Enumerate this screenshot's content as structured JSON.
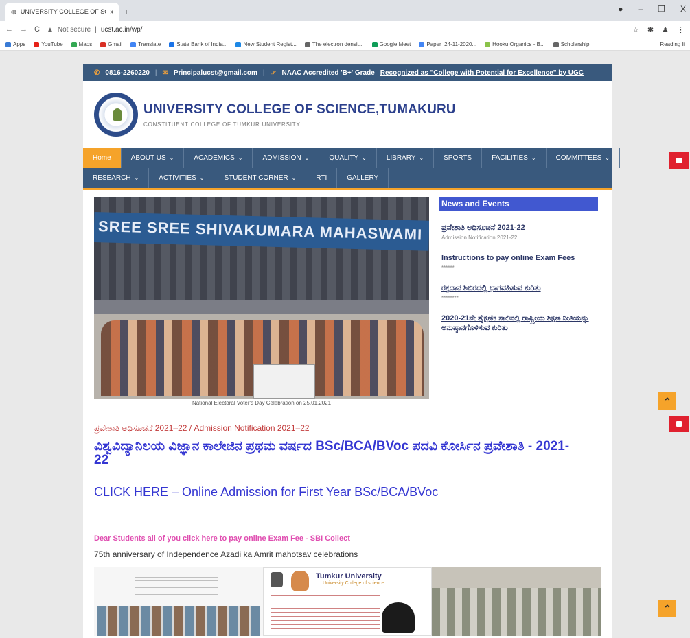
{
  "browser": {
    "tab_title": "UNIVERSITY COLLEGE OF SCIEN",
    "tab_close": "x",
    "new_tab": "+",
    "controls": {
      "minimize": "–",
      "restore": "❐",
      "close": "X"
    },
    "not_secure": "Not secure",
    "url": "ucst.ac.in/wp/",
    "bookmarks": [
      {
        "label": "Apps",
        "color": "#3a7bd5"
      },
      {
        "label": "YouTube",
        "color": "#e62117"
      },
      {
        "label": "Maps",
        "color": "#34a853"
      },
      {
        "label": "Gmail",
        "color": "#d93025"
      },
      {
        "label": "Translate",
        "color": "#4285f4"
      },
      {
        "label": "State Bank of India...",
        "color": "#1a73e8"
      },
      {
        "label": "New Student Regist...",
        "color": "#1e88e5"
      },
      {
        "label": "The electron densit...",
        "color": "#666666"
      },
      {
        "label": "Google Meet",
        "color": "#0f9d58"
      },
      {
        "label": "Paper_24-11-2020...",
        "color": "#4285f4"
      },
      {
        "label": "Hooku Organics - B...",
        "color": "#8bc34a"
      },
      {
        "label": "Scholarship",
        "color": "#666666"
      }
    ],
    "reading_list": "Reading li"
  },
  "site": {
    "phone": "0816-2260220",
    "email": "Principalucst@gmail.com",
    "naac": "NAAC Accredited 'B+' Grade",
    "ugc": "Recognized as \"College with Potential for Excellence\" by UGC",
    "title": "UNIVERSITY COLLEGE OF SCIENCE,TUMAKURU",
    "subtitle": "CONSTITUENT COLLEGE OF TUMKUR UNIVERSITY",
    "nav_row1": [
      {
        "label": "Home",
        "active": true,
        "dropdown": false
      },
      {
        "label": "ABOUT US",
        "dropdown": true
      },
      {
        "label": "ACADEMICS",
        "dropdown": true
      },
      {
        "label": "ADMISSION",
        "dropdown": true
      },
      {
        "label": "QUALITY",
        "dropdown": true
      },
      {
        "label": "LIBRARY",
        "dropdown": true
      },
      {
        "label": "SPORTS",
        "dropdown": false
      },
      {
        "label": "FACILITIES",
        "dropdown": true
      },
      {
        "label": "COMMITTEES",
        "dropdown": true
      }
    ],
    "nav_row2": [
      {
        "label": "RESEARCH",
        "dropdown": true
      },
      {
        "label": "ACTIVITIES",
        "dropdown": true
      },
      {
        "label": "STUDENT CORNER",
        "dropdown": true
      },
      {
        "label": "RTI",
        "dropdown": false
      },
      {
        "label": "GALLERY",
        "dropdown": false
      }
    ],
    "hero_banner_text": "SREE SREE SHIVAKUMARA MAHASWAMI",
    "hero_caption": "National Electoral Voter's Day Celebration on 25.01.2021",
    "news_heading": "News and Events",
    "news": [
      {
        "title": "ಪ್ರವೇಶಾತಿ ಅಧಿಸೂಚನೆ 2021-22",
        "sub": "Admission Notification 2021-22"
      },
      {
        "title": "Instructions to pay online Exam Fees",
        "sub": "******"
      },
      {
        "title": "ರಕ್ತದಾನ ಶಿಬಿರದಲ್ಲಿ ಭಾಗವಹಿಸುವ ಕುರಿತು",
        "sub": "********"
      },
      {
        "title": "2020-21ನೇ ಶೈಕ್ಷಣಿಕ ಸಾಲಿನಲ್ಲಿ ರಾಷ್ಟ್ರೀಯ ಶಿಕ್ಷಣ ನೀತಿಯನ್ನು ಅನುಷ್ಠಾನಗೊಳಿಸುವ ಕುರಿತು",
        "sub": ""
      }
    ],
    "notice_line": "ಪ್ರವೇಶಾತಿ ಅಧಿಸೂಚನೆ 2021–22 / Admission Notification 2021–22",
    "big_title": "ವಿಶ್ವವಿದ್ಯಾನಿಲಯ ವಿಜ್ಞಾನ ಕಾಲೇಜಿನ ಪ್ರಥಮ ವರ್ಷದ BSc/BCA/BVoc ಪದವಿ ಕೋರ್ಸಿನ ಪ್ರವೇಶಾತಿ - 2021-22",
    "click_here": "CLICK HERE – Online Admission for First Year BSc/BCA/BVoc",
    "exam_fee_link": "Dear Students all of you click here to pay online Exam Fee - SBI Collect",
    "anniversary": "75th anniversary of Independence Azadi ka Amrit mahotsav celebrations",
    "gallery_brand": "Tumkur University",
    "gallery_brand_sub": "University College of science",
    "up_arrow": "⌃"
  }
}
